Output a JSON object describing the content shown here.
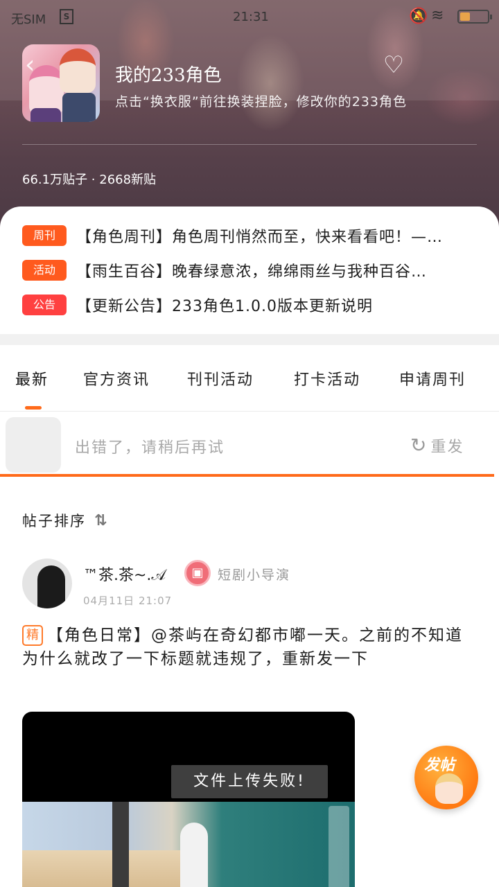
{
  "status_bar": {
    "carrier": "无SIM",
    "time": "21:31"
  },
  "community": {
    "title": "我的233角色",
    "description": "点击“换衣服”前往换装捏脸，修改你的233角色",
    "stats": "66.1万贴子 · 2668新贴"
  },
  "notices": [
    {
      "tag": "周刊",
      "color": "#ff5a1e",
      "text": "【角色周刊】角色周刊悄然而至，快来看看吧！—…"
    },
    {
      "tag": "活动",
      "color": "#ff5a1e",
      "text": "【雨生百谷】晚春绿意浓，绵绵雨丝与我种百谷…"
    },
    {
      "tag": "公告",
      "color": "#ff4040",
      "text": "【更新公告】233角色1.0.0版本更新说明"
    }
  ],
  "tabs": [
    "最新",
    "官方资讯",
    "刊刊活动",
    "打卡活动",
    "申请周刊"
  ],
  "error_bar": {
    "message": "出错了，请稍后再试",
    "retry_label": "重发",
    "progress": 0.99
  },
  "sort": {
    "label": "帖子排序"
  },
  "post": {
    "author": "™茶.茶~.𝒜",
    "badge_label": "短剧小导演",
    "time": "04月11日 21:07",
    "tag": "精",
    "content": "【角色日常】@茶屿在奇幻都市嘟一天。之前的不知道为什么就改了一下标题就违规了，重新发一下",
    "media_error": "文件上传失败!"
  },
  "fab": {
    "label": "发帖"
  }
}
